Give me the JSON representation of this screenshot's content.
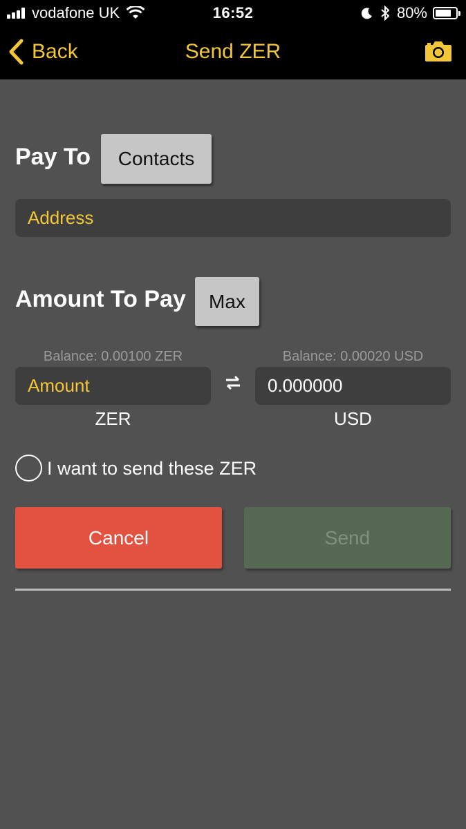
{
  "status_bar": {
    "carrier": "vodafone UK",
    "time": "16:52",
    "battery_percent": "80%",
    "battery_level": 0.8
  },
  "nav": {
    "back_label": "Back",
    "title": "Send ZER",
    "accent_color": "#f3c737"
  },
  "pay_to": {
    "label": "Pay To",
    "contacts_button": "Contacts",
    "address_placeholder": "Address"
  },
  "amount": {
    "label": "Amount To Pay",
    "max_button": "Max",
    "zer_balance": "Balance: 0.00100  ZER",
    "usd_balance": "Balance: 0.00020 USD",
    "zer_placeholder": "Amount",
    "usd_value": "0.000000",
    "zer_unit": "ZER",
    "usd_unit": "USD"
  },
  "confirm": {
    "label": "I want to send these ZER",
    "checked": false
  },
  "actions": {
    "cancel_label": "Cancel",
    "send_label": "Send",
    "cancel_color": "#e35140",
    "send_color": "#566a53"
  },
  "icons": {
    "back": "chevron-left-icon",
    "camera": "camera-icon",
    "swap": "swap-arrows-icon",
    "wifi": "wifi-icon",
    "bluetooth": "bluetooth-icon",
    "moon": "moon-icon"
  }
}
